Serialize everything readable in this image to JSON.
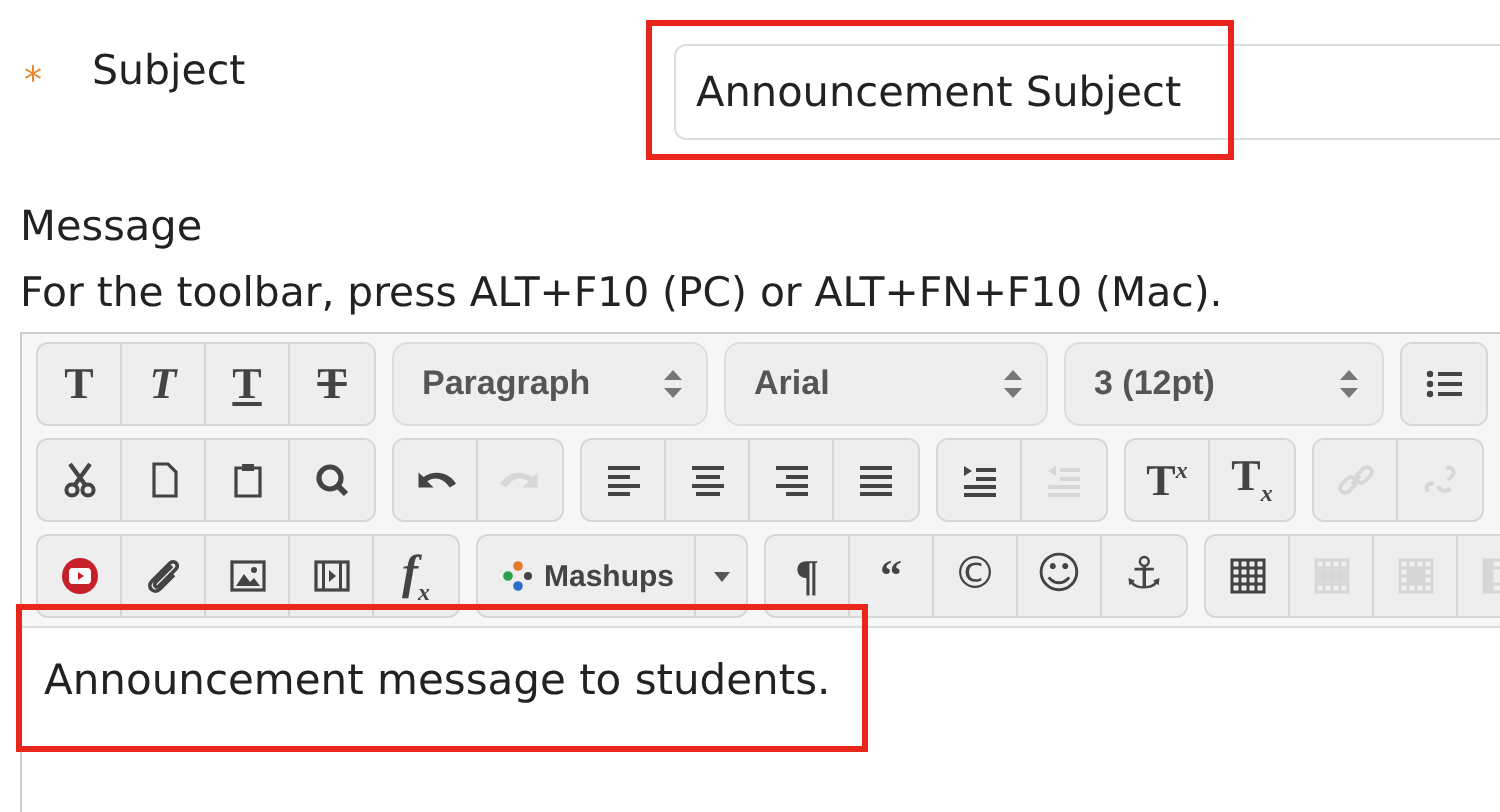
{
  "subject": {
    "label": "Subject",
    "required_mark": "*",
    "value": "Announcement Subject",
    "highlighted": true
  },
  "message": {
    "label": "Message",
    "hint": "For the toolbar, press ALT+F10 (PC) or ALT+FN+F10 (Mac).",
    "toolbar": [
      [
        {
          "kind": "buttons",
          "buttons": [
            {
              "kind": "bold",
              "text": "T",
              "disabled": false
            },
            {
              "kind": "italic",
              "text": "T",
              "disabled": false
            },
            {
              "kind": "underline",
              "text": "T",
              "disabled": false
            },
            {
              "kind": "strike",
              "text": "T",
              "disabled": false
            }
          ]
        },
        {
          "kind": "select",
          "value": "Paragraph"
        },
        {
          "kind": "select",
          "value": "Arial"
        },
        {
          "kind": "select",
          "value": "3 (12pt)"
        },
        {
          "kind": "buttons",
          "buttons": [
            {
              "kind": "bullets",
              "disabled": false
            }
          ]
        }
      ],
      [
        {
          "kind": "buttons",
          "buttons": [
            {
              "kind": "cut",
              "disabled": false
            },
            {
              "kind": "copy",
              "disabled": false
            },
            {
              "kind": "paste",
              "disabled": false
            },
            {
              "kind": "find",
              "disabled": false
            }
          ]
        },
        {
          "kind": "buttons",
          "buttons": [
            {
              "kind": "undo",
              "disabled": false
            },
            {
              "kind": "redo",
              "disabled": true
            }
          ]
        },
        {
          "kind": "buttons",
          "buttons": [
            {
              "kind": "alignleft",
              "disabled": false
            },
            {
              "kind": "aligncenter",
              "disabled": false
            },
            {
              "kind": "alignright",
              "disabled": false
            },
            {
              "kind": "justify",
              "disabled": false
            }
          ]
        },
        {
          "kind": "buttons",
          "buttons": [
            {
              "kind": "indent",
              "disabled": false
            },
            {
              "kind": "outdent",
              "disabled": true
            }
          ]
        },
        {
          "kind": "buttons",
          "buttons": [
            {
              "kind": "superscript",
              "text": "T$^{x}$",
              "disabled": false
            },
            {
              "kind": "subscript",
              "text": "T$_{x}$",
              "disabled": false
            }
          ]
        },
        {
          "kind": "buttons",
          "buttons": [
            {
              "kind": "link",
              "disabled": true
            },
            {
              "kind": "unlink",
              "disabled": true
            }
          ]
        }
      ],
      [
        {
          "kind": "buttons",
          "buttons": [
            {
              "kind": "video",
              "disabled": false
            },
            {
              "kind": "attach",
              "disabled": false
            },
            {
              "kind": "image",
              "disabled": false
            },
            {
              "kind": "media",
              "disabled": false
            },
            {
              "kind": "formula",
              "text": "f$_{x}$",
              "disabled": false
            }
          ]
        },
        {
          "kind": "split",
          "value": "Mashups"
        },
        {
          "kind": "buttons",
          "buttons": [
            {
              "kind": "paragraph",
              "text": "¶",
              "disabled": false
            },
            {
              "kind": "quote",
              "text": "“",
              "disabled": false
            },
            {
              "kind": "copyright",
              "text": "©",
              "disabled": false
            },
            {
              "kind": "emoticon",
              "text": "☺",
              "disabled": false
            },
            {
              "kind": "anchor",
              "text": "⚓",
              "disabled": false
            }
          ]
        },
        {
          "kind": "buttons",
          "buttons": [
            {
              "kind": "table",
              "disabled": false
            },
            {
              "kind": "tablerow",
              "disabled": true
            },
            {
              "kind": "tablecell",
              "disabled": true
            },
            {
              "kind": "tablecol",
              "disabled": true
            }
          ]
        }
      ]
    ],
    "body": "Announcement message to students.",
    "highlighted": true
  }
}
